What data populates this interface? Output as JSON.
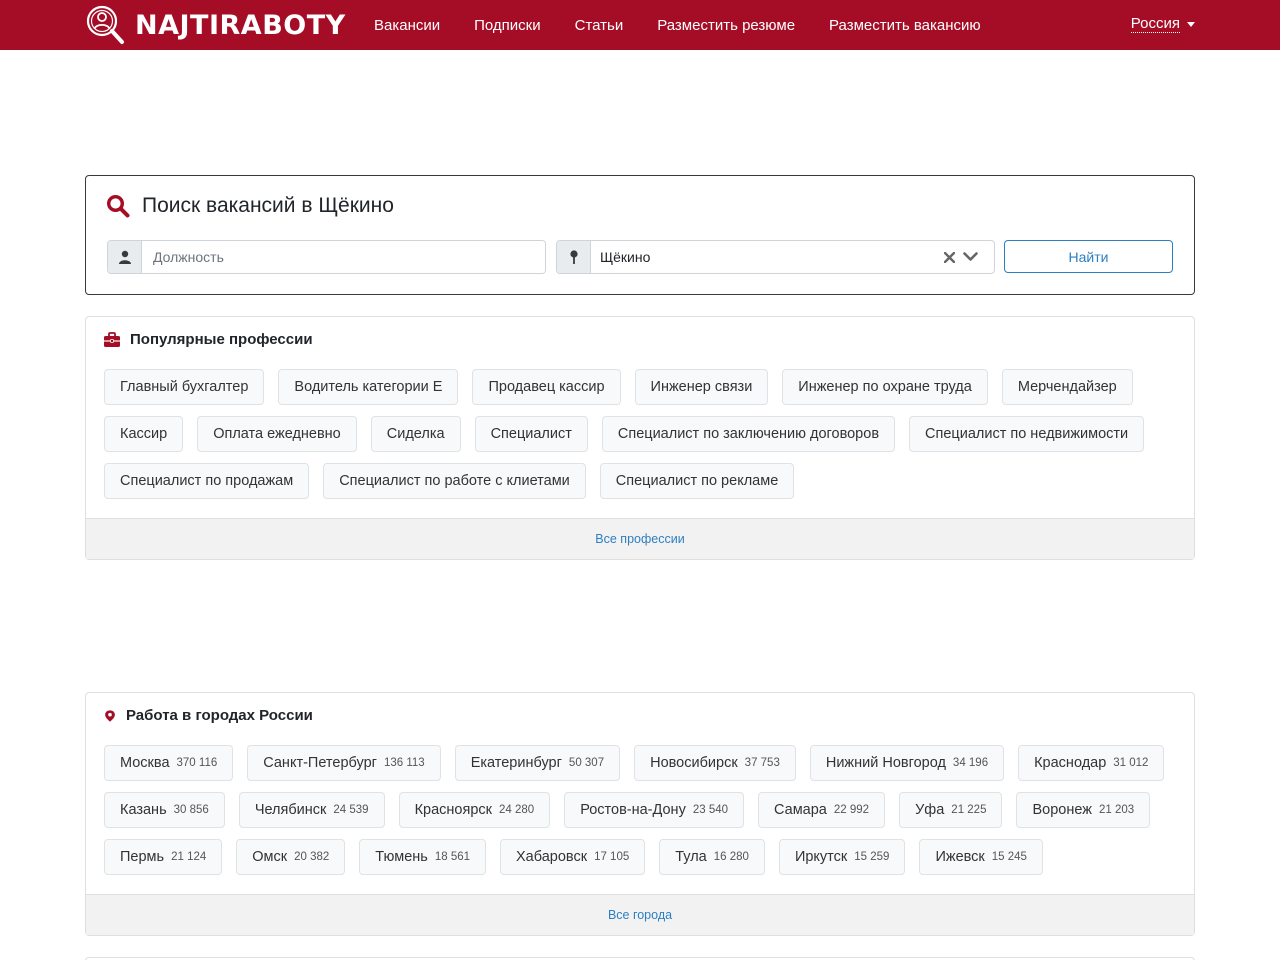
{
  "brand": {
    "name": "NAJTIRABOTY",
    "color": "#a50d26"
  },
  "nav": {
    "links": [
      {
        "label": "Вакансии"
      },
      {
        "label": "Подписки"
      },
      {
        "label": "Статьи"
      },
      {
        "label": "Разместить резюме"
      },
      {
        "label": "Разместить вакансию"
      }
    ],
    "region": "Россия"
  },
  "search": {
    "title": "Поиск вакансий в Щёкино",
    "job_placeholder": "Должность",
    "city_value": "Щёкино",
    "submit_label": "Найти",
    "icons": {
      "title": "search-icon",
      "job": "user-icon",
      "city": "pin-icon",
      "clear": "clear-icon",
      "dropdown": "chevron-down-icon"
    }
  },
  "professions": {
    "title": "Популярные профессии",
    "icon": "briefcase-icon",
    "items": [
      "Главный бухгалтер",
      "Водитель категории Е",
      "Продавец кассир",
      "Инженер связи",
      "Инженер по охране труда",
      "Мерчендайзер",
      "Кассир",
      "Оплата ежедневно",
      "Сиделка",
      "Специалист",
      "Специалист по заключению договоров",
      "Специалист по недвижимости",
      "Специалист по продажам",
      "Специалист по работе с клиетами",
      "Специалист по рекламе"
    ],
    "footer_link": "Все профессии"
  },
  "cities": {
    "title": "Работа в городах России",
    "icon": "map-marker-icon",
    "items": [
      {
        "name": "Москва",
        "count": "370 116"
      },
      {
        "name": "Санкт-Петербург",
        "count": "136 113"
      },
      {
        "name": "Екатеринбург",
        "count": "50 307"
      },
      {
        "name": "Новосибирск",
        "count": "37 753"
      },
      {
        "name": "Нижний Новгород",
        "count": "34 196"
      },
      {
        "name": "Краснодар",
        "count": "31 012"
      },
      {
        "name": "Казань",
        "count": "30 856"
      },
      {
        "name": "Челябинск",
        "count": "24 539"
      },
      {
        "name": "Красноярск",
        "count": "24 280"
      },
      {
        "name": "Ростов-на-Дону",
        "count": "23 540"
      },
      {
        "name": "Самара",
        "count": "22 992"
      },
      {
        "name": "Уфа",
        "count": "21 225"
      },
      {
        "name": "Воронеж",
        "count": "21 203"
      },
      {
        "name": "Пермь",
        "count": "21 124"
      },
      {
        "name": "Омск",
        "count": "20 382"
      },
      {
        "name": "Тюмень",
        "count": "18 561"
      },
      {
        "name": "Хабаровск",
        "count": "17 105"
      },
      {
        "name": "Тула",
        "count": "16 280"
      },
      {
        "name": "Иркутск",
        "count": "15 259"
      },
      {
        "name": "Ижевск",
        "count": "15 245"
      }
    ],
    "footer_link": "Все города"
  }
}
